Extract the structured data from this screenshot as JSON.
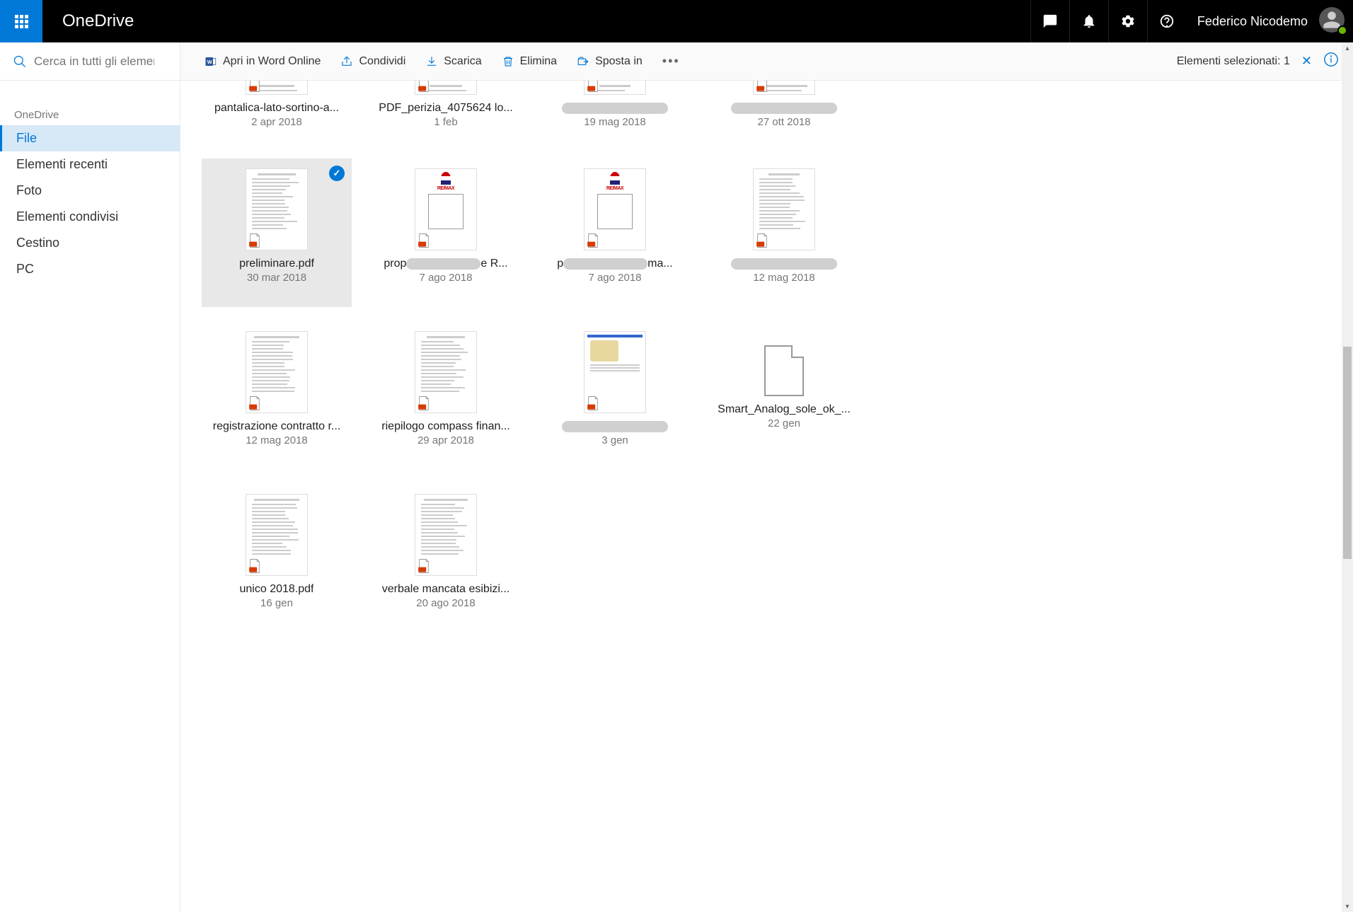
{
  "header": {
    "app_name": "OneDrive",
    "user_name": "Federico Nicodemo"
  },
  "search": {
    "placeholder": "Cerca in tutti gli elementi"
  },
  "nav": {
    "heading": "OneDrive",
    "items": [
      {
        "label": "File",
        "active": true
      },
      {
        "label": "Elementi recenti",
        "active": false
      },
      {
        "label": "Foto",
        "active": false
      },
      {
        "label": "Elementi condivisi",
        "active": false
      },
      {
        "label": "Cestino",
        "active": false
      },
      {
        "label": "PC",
        "active": false
      }
    ]
  },
  "toolbar": {
    "open_label": "Apri in Word Online",
    "share_label": "Condividi",
    "download_label": "Scarica",
    "delete_label": "Elimina",
    "move_label": "Sposta in",
    "selection_label": "Elementi selezionati: 1"
  },
  "files": [
    {
      "name": "pantalica-lato-sortino-a...",
      "date": "2 apr 2018",
      "selected": false,
      "partial": true,
      "redacted": false,
      "thumb": "lines",
      "pdf": true
    },
    {
      "name": "PDF_perizia_4075624 lo...",
      "date": "1 feb",
      "selected": false,
      "partial": true,
      "redacted": false,
      "thumb": "lines",
      "pdf": true
    },
    {
      "name": "xxxxxxxxxxxxxxxxxxxxxxxxxxx0...",
      "date": "19 mag 2018",
      "selected": false,
      "partial": true,
      "redacted": true,
      "thumb": "lines",
      "pdf": true
    },
    {
      "name": "xxxxxxxxxxxxxxxxxxxxxxx",
      "date": "27 ott 2018",
      "selected": false,
      "partial": true,
      "redacted": true,
      "thumb": "lines",
      "pdf": true
    },
    {
      "name": "preliminare.pdf",
      "date": "30 mar 2018",
      "selected": true,
      "partial": false,
      "redacted": false,
      "thumb": "lines",
      "pdf": true
    },
    {
      "name": "propxxxxxxxxxxxxxxxe R...",
      "date": "7 ago 2018",
      "selected": false,
      "partial": false,
      "redacted": "partial",
      "thumb": "remax",
      "pdf": true
    },
    {
      "name": "pxxxxxxxxxxxxxxxxxma...",
      "date": "7 ago 2018",
      "selected": false,
      "partial": false,
      "redacted": "partial",
      "thumb": "remax",
      "pdf": true
    },
    {
      "name": "xxxxxxxxxxxxxxxxxxxxxxxxx",
      "date": "12 mag 2018",
      "selected": false,
      "partial": false,
      "redacted": true,
      "thumb": "lines",
      "pdf": true
    },
    {
      "name": "registrazione contratto r...",
      "date": "12 mag 2018",
      "selected": false,
      "partial": false,
      "redacted": false,
      "thumb": "lines",
      "pdf": true
    },
    {
      "name": "riepilogo compass finan...",
      "date": "29 apr 2018",
      "selected": false,
      "partial": false,
      "redacted": false,
      "thumb": "lines",
      "pdf": true
    },
    {
      "name": "xxxxxxxxxxxxxxxxxxxxxxx - ...",
      "date": "3 gen",
      "selected": false,
      "partial": false,
      "redacted": true,
      "thumb": "web",
      "pdf": true
    },
    {
      "name": "Smart_Analog_sole_ok_...",
      "date": "22 gen",
      "selected": false,
      "partial": false,
      "redacted": false,
      "thumb": "plain",
      "pdf": false
    },
    {
      "name": "unico 2018.pdf",
      "date": "16 gen",
      "selected": false,
      "partial": false,
      "redacted": false,
      "thumb": "lines",
      "pdf": true
    },
    {
      "name": "verbale mancata esibizi...",
      "date": "20 ago 2018",
      "selected": false,
      "partial": false,
      "redacted": false,
      "thumb": "lines",
      "pdf": true
    }
  ]
}
